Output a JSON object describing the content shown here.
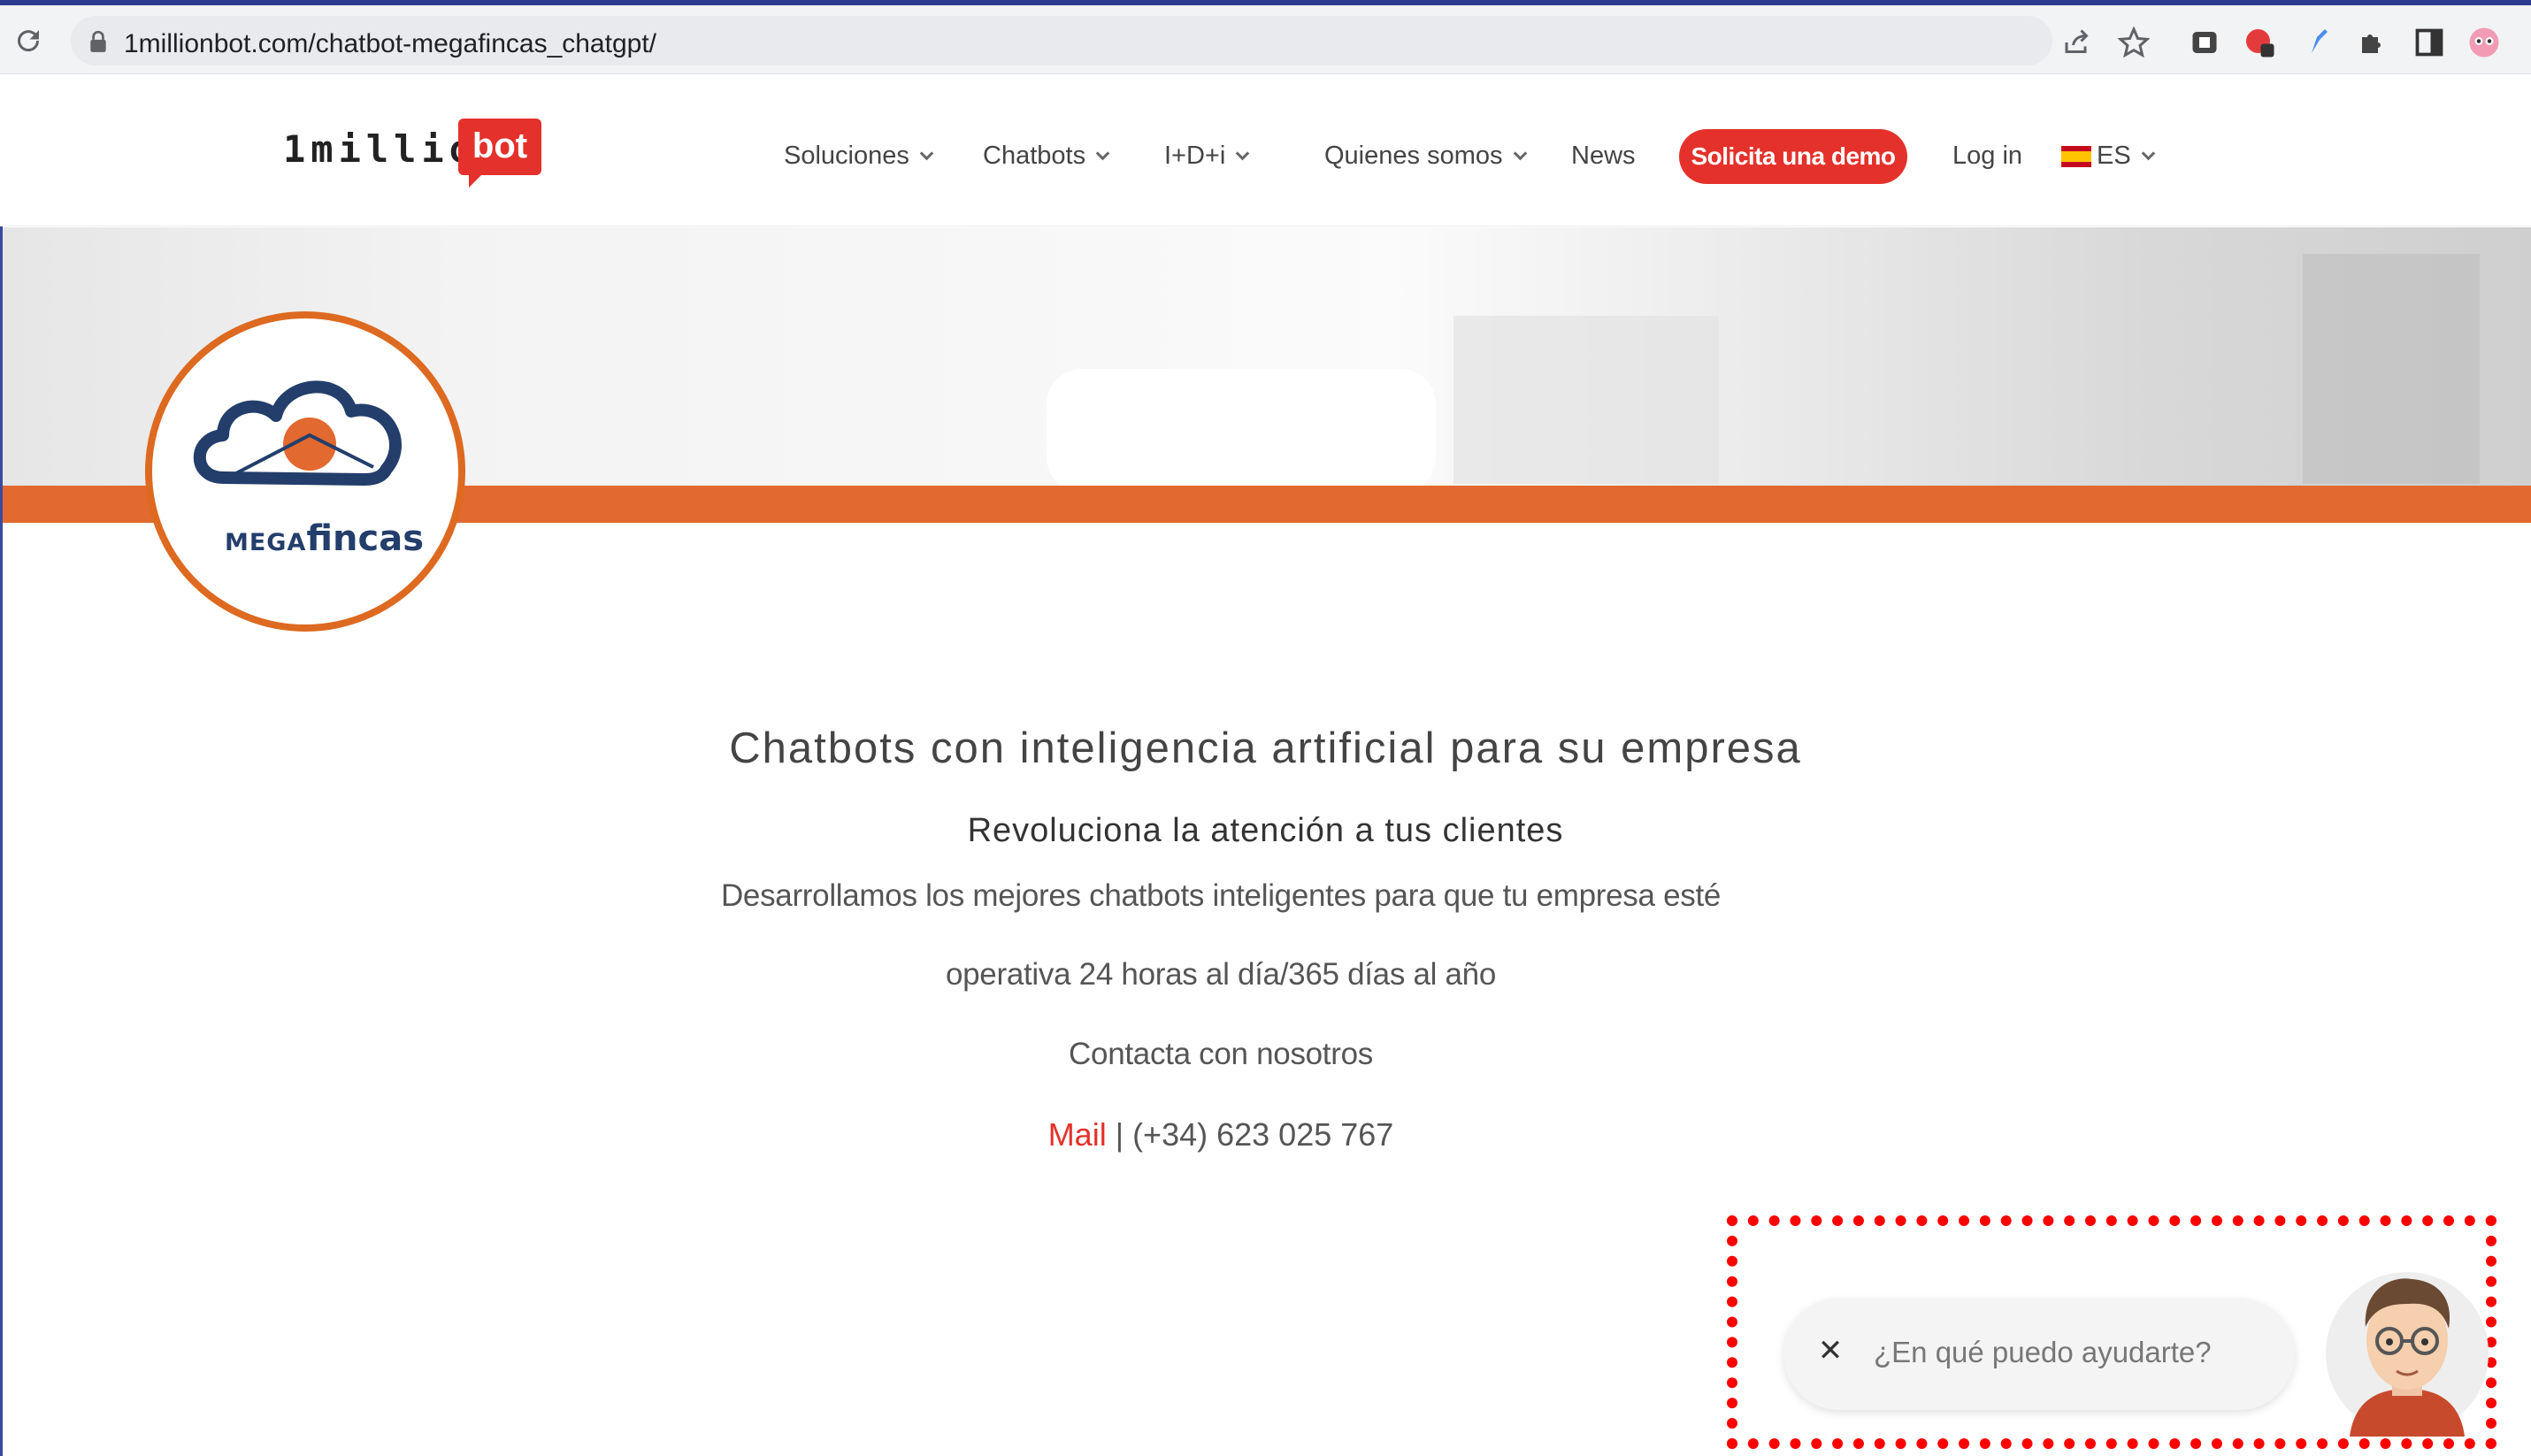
{
  "browser": {
    "url": "1millionbot.com/chatbot-megafincas_chatgpt/"
  },
  "header": {
    "logo_text": "1million",
    "logo_badge": "bot",
    "nav": [
      {
        "label": "Soluciones",
        "has_dropdown": true
      },
      {
        "label": "Chatbots",
        "has_dropdown": true
      },
      {
        "label": "I+D+i",
        "has_dropdown": true
      },
      {
        "label": "Quienes somos",
        "has_dropdown": true
      },
      {
        "label": "News",
        "has_dropdown": false
      }
    ],
    "demo_button": "Solicita una demo",
    "login": "Log in",
    "language": "ES",
    "accent_color": "#e4312b"
  },
  "client_logo": {
    "prefix": "MEGA",
    "name": "fincas",
    "ring_color": "#dd6a20"
  },
  "main": {
    "headline": "Chatbots con inteligencia artificial para su empresa",
    "subheadline": "Revoluciona la atención a tus clientes",
    "line1": "Desarrollamos los mejores chatbots inteligentes para que tu empresa esté",
    "line2": "operativa 24 horas al día/365 días al año",
    "contact_title": "Contacta con nosotros",
    "mail_link": "Mail",
    "separator": " | ",
    "phone": "(+34) 623 025 767"
  },
  "chat_widget": {
    "prompt": "¿En qué puedo ayudarte?",
    "close_symbol": "✕",
    "highlight_color": "#ff0000"
  }
}
